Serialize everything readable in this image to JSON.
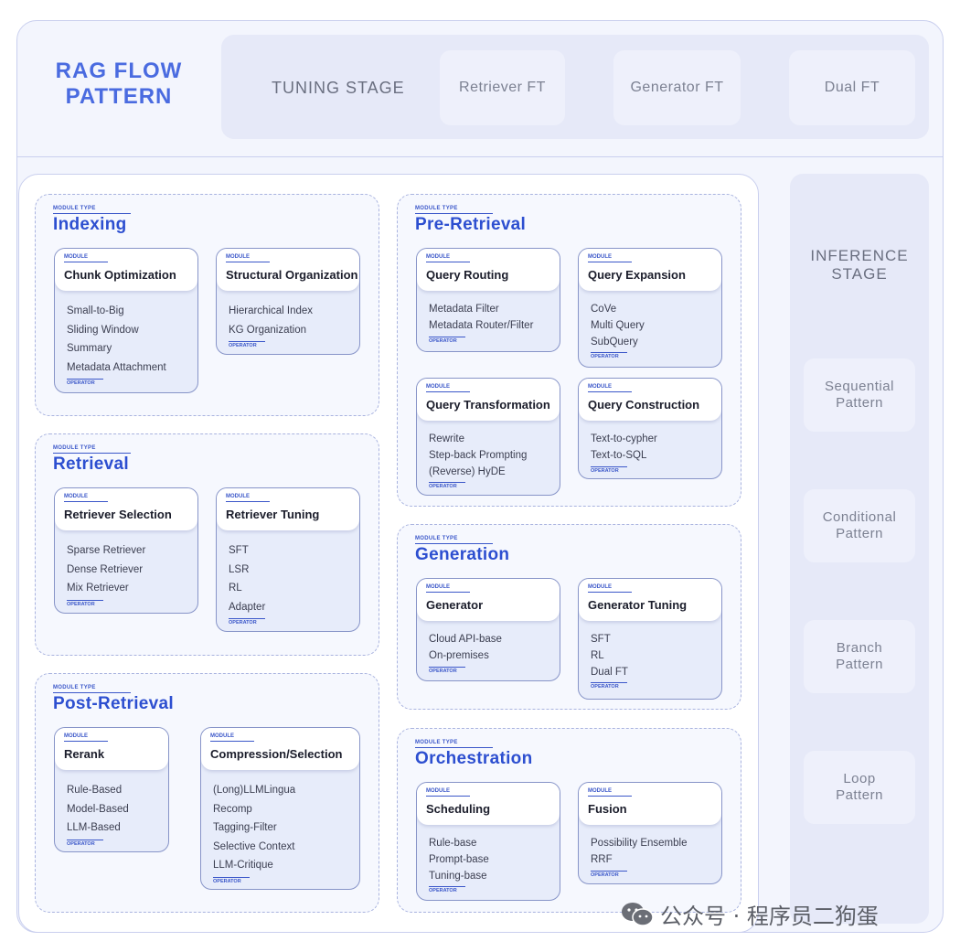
{
  "title_line1": "RAG FLOW",
  "title_line2": "PATTERN",
  "tuning": {
    "label": "TUNING STAGE",
    "items": [
      "Retriever FT",
      "Generator FT",
      "Dual FT"
    ]
  },
  "inference": {
    "label_line1": "INFERENCE",
    "label_line2": "STAGE",
    "patterns": [
      {
        "line1": "Sequential",
        "line2": "Pattern"
      },
      {
        "line1": "Conditional",
        "line2": "Pattern"
      },
      {
        "line1": "Branch",
        "line2": "Pattern"
      },
      {
        "line1": "Loop",
        "line2": "Pattern"
      }
    ]
  },
  "labels": {
    "module_type": "MODULE TYPE",
    "module": "MODULE",
    "operator": "OPERATOR"
  },
  "module_types": [
    {
      "name": "Indexing",
      "modules": [
        {
          "title": "Chunk Optimization",
          "operators": [
            "Small-to-Big",
            "Sliding Window",
            "Summary",
            "Metadata Attachment"
          ]
        },
        {
          "title": "Structural Organization",
          "operators": [
            "Hierarchical Index",
            "KG Organization"
          ]
        }
      ]
    },
    {
      "name": "Retrieval",
      "modules": [
        {
          "title": "Retriever Selection",
          "operators": [
            "Sparse Retriever",
            "Dense Retriever",
            "Mix Retriever"
          ]
        },
        {
          "title": "Retriever Tuning",
          "operators": [
            "SFT",
            "LSR",
            "RL",
            "Adapter"
          ]
        }
      ]
    },
    {
      "name": "Post-Retrieval",
      "modules": [
        {
          "title": "Rerank",
          "operators": [
            "Rule-Based",
            "Model-Based",
            "LLM-Based"
          ]
        },
        {
          "title": "Compression/Selection",
          "operators": [
            "(Long)LLMLingua",
            "Recomp",
            "Tagging-Filter",
            "Selective Context",
            "LLM-Critique"
          ]
        }
      ]
    },
    {
      "name": "Pre-Retrieval",
      "modules": [
        {
          "title": "Query Routing",
          "operators": [
            "Metadata Filter",
            "Metadata Router/Filter"
          ]
        },
        {
          "title": "Query Expansion",
          "operators": [
            "CoVe",
            "Multi Query",
            "SubQuery"
          ]
        },
        {
          "title": "Query Transformation",
          "operators": [
            "Rewrite",
            "Step-back Prompting",
            "(Reverse) HyDE"
          ]
        },
        {
          "title": "Query Construction",
          "operators": [
            "Text-to-cypher",
            "Text-to-SQL"
          ]
        }
      ]
    },
    {
      "name": "Generation",
      "modules": [
        {
          "title": "Generator",
          "operators": [
            "Cloud API-base",
            "On-premises"
          ]
        },
        {
          "title": "Generator Tuning",
          "operators": [
            "SFT",
            "RL",
            "Dual FT"
          ]
        }
      ]
    },
    {
      "name": "Orchestration",
      "modules": [
        {
          "title": "Scheduling",
          "operators": [
            "Rule-base",
            "Prompt-base",
            "Tuning-base"
          ]
        },
        {
          "title": "Fusion",
          "operators": [
            "Possibility Ensemble",
            "RRF"
          ]
        }
      ]
    }
  ],
  "watermark": "公众号 · 程序员二狗蛋",
  "colors": {
    "accent": "#2d4fd0",
    "title": "#4a6be0",
    "panel": "#e6e9f8"
  }
}
